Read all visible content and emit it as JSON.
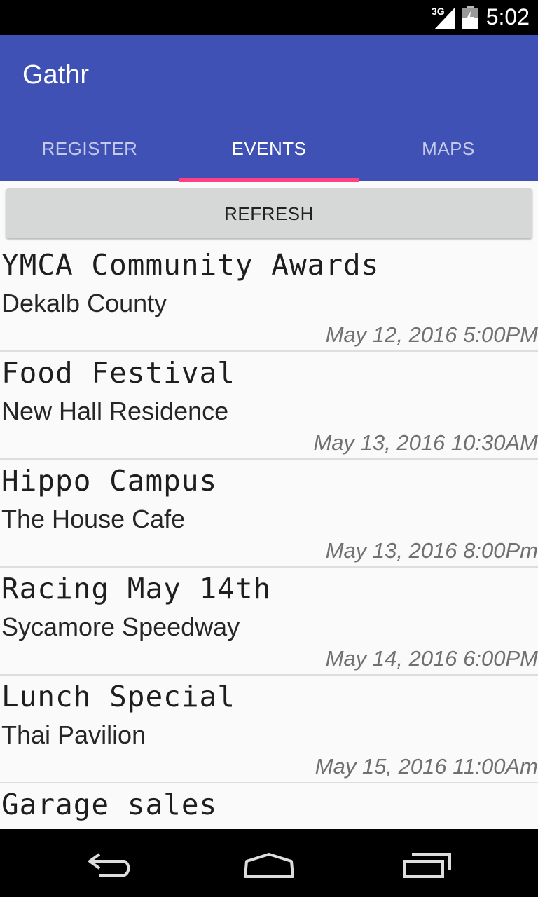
{
  "status_bar": {
    "network_label": "3G",
    "time": "5:02",
    "signal_icon": "signal-icon",
    "battery_icon": "battery-charging-icon"
  },
  "app_bar": {
    "title": "Gathr"
  },
  "tabs": [
    {
      "label": "REGISTER",
      "active": false
    },
    {
      "label": "EVENTS",
      "active": true
    },
    {
      "label": "MAPS",
      "active": false
    }
  ],
  "refresh_label": "REFRESH",
  "events": [
    {
      "title": "YMCA Community Awards",
      "venue": "Dekalb County",
      "datetime": "May 12, 2016 5:00PM"
    },
    {
      "title": "Food Festival",
      "venue": "New Hall Residence",
      "datetime": "May 13, 2016 10:30AM"
    },
    {
      "title": "Hippo Campus",
      "venue": "The House Cafe",
      "datetime": "May 13, 2016 8:00Pm"
    },
    {
      "title": "Racing May 14th",
      "venue": "Sycamore Speedway",
      "datetime": "May 14, 2016 6:00PM"
    },
    {
      "title": "Lunch Special",
      "venue": "Thai Pavilion",
      "datetime": "May 15, 2016 11:00Am"
    },
    {
      "title": "Garage sales",
      "venue": "",
      "datetime": ""
    }
  ],
  "nav_bar": {
    "back_icon": "back-icon",
    "home_icon": "home-icon",
    "recents_icon": "recents-icon"
  },
  "colors": {
    "primary": "#3f51b5",
    "accent": "#ff4081",
    "button_bg": "#d6d7d7",
    "list_bg": "#fafafa"
  }
}
